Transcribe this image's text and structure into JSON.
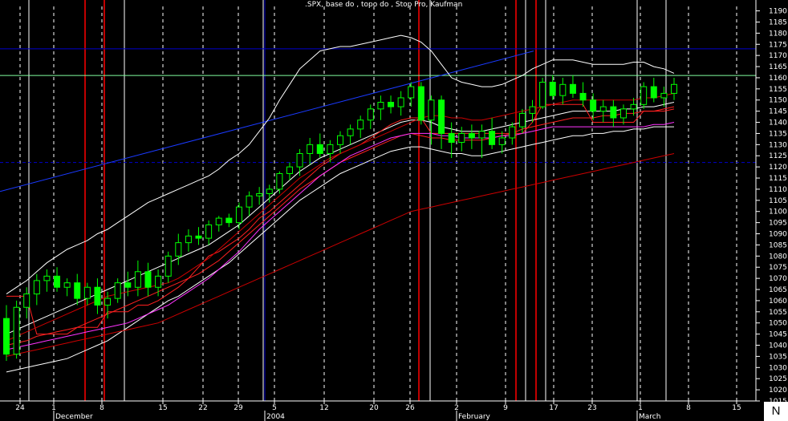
{
  "title": ".SPX, base do , topo do , Stop Pro, Kaufman",
  "corner_label": "N",
  "colors": {
    "background": "#000000",
    "up_candle": "#00ff00",
    "guide_white": "#ffffff",
    "guide_red": "#c00000",
    "guide_blue": "#0000cc",
    "level_line": "#7fff9f",
    "band": "#ffffff",
    "stop": "#ff2020",
    "ma_magenta": "#ff33ff",
    "ma_red": "#cc0000",
    "trend": "#1a3aff"
  },
  "chart_data": {
    "type": "candlestick",
    "title": ".SPX, base do , topo do , Stop Pro, Kaufman",
    "ylim": [
      1015,
      1192
    ],
    "yticks": [
      1015,
      1020,
      1025,
      1030,
      1035,
      1040,
      1045,
      1050,
      1055,
      1060,
      1065,
      1070,
      1075,
      1080,
      1085,
      1090,
      1095,
      1100,
      1105,
      1110,
      1115,
      1120,
      1125,
      1130,
      1135,
      1140,
      1145,
      1150,
      1155,
      1160,
      1165,
      1170,
      1175,
      1180,
      1185,
      1190
    ],
    "x_day_labels": [
      "24",
      "1",
      "8",
      "15",
      "22",
      "29",
      "5",
      "12",
      "20",
      "26",
      "2",
      "9",
      "17",
      "23",
      "1",
      "8",
      "15"
    ],
    "x_month_labels": [
      "December",
      "2004",
      "February",
      "March"
    ],
    "horizontal_levels": [
      1173,
      1161,
      1122
    ],
    "trend_line": {
      "from": [
        1109,
        "24"
      ],
      "to": [
        1172,
        "9"
      ]
    },
    "candles": [
      [
        1052,
        1058,
        1033,
        1036
      ],
      [
        1036,
        1060,
        1034,
        1057
      ],
      [
        1057,
        1066,
        1052,
        1063
      ],
      [
        1063,
        1072,
        1058,
        1069
      ],
      [
        1069,
        1074,
        1064,
        1071
      ],
      [
        1071,
        1075,
        1064,
        1066
      ],
      [
        1066,
        1070,
        1062,
        1068
      ],
      [
        1068,
        1072,
        1058,
        1061
      ],
      [
        1061,
        1068,
        1058,
        1066
      ],
      [
        1066,
        1070,
        1054,
        1058
      ],
      [
        1058,
        1064,
        1052,
        1061
      ],
      [
        1061,
        1070,
        1059,
        1068
      ],
      [
        1068,
        1073,
        1062,
        1066
      ],
      [
        1066,
        1078,
        1062,
        1073
      ],
      [
        1073,
        1077,
        1062,
        1066
      ],
      [
        1066,
        1074,
        1062,
        1071
      ],
      [
        1071,
        1082,
        1068,
        1080
      ],
      [
        1080,
        1090,
        1076,
        1086
      ],
      [
        1086,
        1092,
        1082,
        1089
      ],
      [
        1089,
        1093,
        1085,
        1088
      ],
      [
        1088,
        1096,
        1085,
        1094
      ],
      [
        1094,
        1098,
        1091,
        1097
      ],
      [
        1097,
        1099,
        1093,
        1095
      ],
      [
        1095,
        1104,
        1092,
        1102
      ],
      [
        1102,
        1109,
        1098,
        1107
      ],
      [
        1107,
        1111,
        1103,
        1108
      ],
      [
        1108,
        1112,
        1104,
        1110
      ],
      [
        1110,
        1118,
        1108,
        1117
      ],
      [
        1117,
        1122,
        1114,
        1120
      ],
      [
        1120,
        1128,
        1116,
        1126
      ],
      [
        1126,
        1133,
        1121,
        1130
      ],
      [
        1130,
        1135,
        1124,
        1126
      ],
      [
        1126,
        1132,
        1122,
        1130
      ],
      [
        1130,
        1136,
        1126,
        1134
      ],
      [
        1134,
        1139,
        1130,
        1137
      ],
      [
        1137,
        1143,
        1133,
        1141
      ],
      [
        1141,
        1148,
        1137,
        1146
      ],
      [
        1146,
        1152,
        1141,
        1149
      ],
      [
        1149,
        1152,
        1144,
        1147
      ],
      [
        1147,
        1154,
        1143,
        1151
      ],
      [
        1151,
        1158,
        1147,
        1156
      ],
      [
        1156,
        1158,
        1139,
        1141
      ],
      [
        1141,
        1152,
        1130,
        1150
      ],
      [
        1150,
        1152,
        1128,
        1135
      ],
      [
        1135,
        1140,
        1124,
        1131
      ],
      [
        1131,
        1138,
        1127,
        1135
      ],
      [
        1135,
        1139,
        1128,
        1133
      ],
      [
        1133,
        1139,
        1124,
        1136
      ],
      [
        1136,
        1142,
        1128,
        1130
      ],
      [
        1130,
        1136,
        1126,
        1133
      ],
      [
        1133,
        1140,
        1130,
        1138
      ],
      [
        1138,
        1146,
        1135,
        1144
      ],
      [
        1144,
        1150,
        1140,
        1147
      ],
      [
        1147,
        1160,
        1146,
        1158
      ],
      [
        1158,
        1161,
        1150,
        1152
      ],
      [
        1152,
        1160,
        1148,
        1157
      ],
      [
        1157,
        1161,
        1151,
        1153
      ],
      [
        1153,
        1158,
        1147,
        1150
      ],
      [
        1150,
        1153,
        1141,
        1145
      ],
      [
        1145,
        1150,
        1140,
        1147
      ],
      [
        1147,
        1150,
        1138,
        1142
      ],
      [
        1142,
        1148,
        1139,
        1146
      ],
      [
        1146,
        1151,
        1143,
        1148
      ],
      [
        1148,
        1158,
        1146,
        1156
      ],
      [
        1156,
        1160,
        1149,
        1151
      ],
      [
        1151,
        1156,
        1147,
        1153
      ],
      [
        1153,
        1160,
        1150,
        1157
      ]
    ],
    "overlays": [
      {
        "name": "upper band",
        "color": "band",
        "values": [
          1063,
          1066,
          1069,
          1073,
          1077,
          1080,
          1083,
          1085,
          1087,
          1090,
          1092,
          1095,
          1098,
          1101,
          1104,
          1106,
          1108,
          1110,
          1112,
          1114,
          1116,
          1119,
          1123,
          1126,
          1130,
          1136,
          1142,
          1150,
          1157,
          1164,
          1168,
          1172,
          1173,
          1174,
          1174,
          1175,
          1176,
          1177,
          1178,
          1179,
          1178,
          1176,
          1172,
          1166,
          1160,
          1158,
          1157,
          1156,
          1156,
          1157,
          1159,
          1161,
          1164,
          1166,
          1168,
          1168,
          1168,
          1167,
          1166,
          1166,
          1166,
          1166,
          1167,
          1167,
          1165,
          1164,
          1162
        ]
      },
      {
        "name": "lower band",
        "color": "band",
        "values": [
          1028,
          1029,
          1030,
          1031,
          1032,
          1033,
          1034,
          1036,
          1038,
          1040,
          1042,
          1045,
          1048,
          1051,
          1054,
          1057,
          1060,
          1062,
          1065,
          1068,
          1071,
          1074,
          1077,
          1081,
          1085,
          1089,
          1093,
          1097,
          1101,
          1105,
          1108,
          1111,
          1114,
          1117,
          1119,
          1121,
          1123,
          1125,
          1127,
          1128,
          1129,
          1129,
          1128,
          1127,
          1126,
          1126,
          1125,
          1125,
          1126,
          1127,
          1128,
          1129,
          1130,
          1131,
          1132,
          1133,
          1134,
          1134,
          1135,
          1135,
          1136,
          1136,
          1137,
          1137,
          1138,
          1138,
          1138
        ]
      },
      {
        "name": "middle band",
        "color": "band",
        "values": [
          1045,
          1047,
          1049,
          1051,
          1053,
          1055,
          1057,
          1059,
          1061,
          1063,
          1065,
          1067,
          1069,
          1071,
          1073,
          1075,
          1077,
          1079,
          1081,
          1083,
          1085,
          1088,
          1091,
          1094,
          1098,
          1102,
          1106,
          1110,
          1114,
          1118,
          1121,
          1124,
          1126,
          1128,
          1130,
          1132,
          1134,
          1136,
          1138,
          1140,
          1141,
          1141,
          1140,
          1138,
          1137,
          1136,
          1136,
          1136,
          1137,
          1138,
          1139,
          1140,
          1141,
          1142,
          1143,
          1144,
          1145,
          1145,
          1145,
          1145,
          1145,
          1146,
          1146,
          1147,
          1147,
          1148,
          1149
        ]
      },
      {
        "name": "stop",
        "color": "stop",
        "values": [
          1062,
          1062,
          1062,
          1045,
          1045,
          1045,
          1045,
          1048,
          1048,
          1048,
          1055,
          1055,
          1055,
          1058,
          1058,
          1060,
          1063,
          1066,
          1070,
          1075,
          1080,
          1082,
          1085,
          1088,
          1092,
          1097,
          1100,
          1104,
          1108,
          1112,
          1116,
          1120,
          1123,
          1126,
          1128,
          1130,
          1133,
          1136,
          1139,
          1141,
          1142,
          1142,
          1135,
          1135,
          1135,
          1135,
          1135,
          1135,
          1135,
          1135,
          1135,
          1135,
          1140,
          1148,
          1148,
          1148,
          1148,
          1148,
          1140,
          1140,
          1140,
          1140,
          1140,
          1145,
          1145,
          1145,
          1146
        ]
      },
      {
        "name": "stop 2",
        "color": "stop",
        "values": [
          1040,
          1041,
          1042,
          1044,
          1045,
          1046,
          1047,
          1048,
          1050,
          1052,
          1054,
          1056,
          1058,
          1060,
          1062,
          1064,
          1066,
          1068,
          1070,
          1072,
          1075,
          1078,
          1082,
          1086,
          1090,
          1094,
          1098,
          1102,
          1106,
          1110,
          1113,
          1116,
          1119,
          1122,
          1124,
          1126,
          1128,
          1130,
          1132,
          1134,
          1135,
          1134,
          1133,
          1133,
          1132,
          1132,
          1132,
          1132,
          1133,
          1134,
          1135,
          1137,
          1138,
          1139,
          1140,
          1141,
          1142,
          1142,
          1142,
          1143,
          1143,
          1144,
          1144,
          1145,
          1145,
          1146,
          1147
        ]
      },
      {
        "name": "magenta ma",
        "color": "ma_magenta",
        "values": [
          1038,
          1039,
          1040,
          1041,
          1042,
          1043,
          1044,
          1045,
          1046,
          1047,
          1048,
          1049,
          1050,
          1052,
          1054,
          1056,
          1058,
          1061,
          1064,
          1067,
          1070,
          1074,
          1078,
          1082,
          1087,
          1092,
          1096,
          1100,
          1104,
          1108,
          1112,
          1116,
          1119,
          1122,
          1125,
          1127,
          1129,
          1131,
          1133,
          1134,
          1135,
          1135,
          1135,
          1134,
          1134,
          1133,
          1133,
          1133,
          1133,
          1134,
          1134,
          1135,
          1136,
          1137,
          1138,
          1138,
          1138,
          1138,
          1138,
          1138,
          1138,
          1138,
          1138,
          1138,
          1139,
          1139,
          1140
        ]
      },
      {
        "name": "long ma",
        "color": "ma_red",
        "values": [
          1035,
          1036,
          1037,
          1038,
          1039,
          1040,
          1041,
          1042,
          1043,
          1044,
          1045,
          1046,
          1047,
          1048,
          1049,
          1050,
          1052,
          1054,
          1056,
          1058,
          1060,
          1062,
          1064,
          1066,
          1068,
          1070,
          1072,
          1074,
          1076,
          1078,
          1080,
          1082,
          1084,
          1086,
          1088,
          1090,
          1092,
          1094,
          1096,
          1098,
          1100,
          1101,
          1102,
          1103,
          1104,
          1105,
          1106,
          1107,
          1108,
          1109,
          1110,
          1111,
          1112,
          1113,
          1114,
          1115,
          1116,
          1117,
          1118,
          1119,
          1120,
          1121,
          1122,
          1123,
          1124,
          1125,
          1126
        ]
      },
      {
        "name": "fast ma",
        "color": "ma_red",
        "values": [
          1042,
          1044,
          1046,
          1048,
          1050,
          1052,
          1054,
          1056,
          1058,
          1060,
          1062,
          1063,
          1064,
          1065,
          1066,
          1067,
          1068,
          1070,
          1073,
          1076,
          1079,
          1083,
          1087,
          1091,
          1095,
          1099,
          1103,
          1107,
          1111,
          1115,
          1118,
          1121,
          1124,
          1126,
          1128,
          1130,
          1132,
          1134,
          1136,
          1138,
          1140,
          1142,
          1143,
          1143,
          1142,
          1142,
          1141,
          1141,
          1142,
          1143,
          1144,
          1145,
          1146,
          1147,
          1148,
          1149,
          1150,
          1150,
          1150,
          1150,
          1150,
          1150,
          1150,
          1151,
          1151,
          1152,
          1153
        ]
      }
    ]
  }
}
